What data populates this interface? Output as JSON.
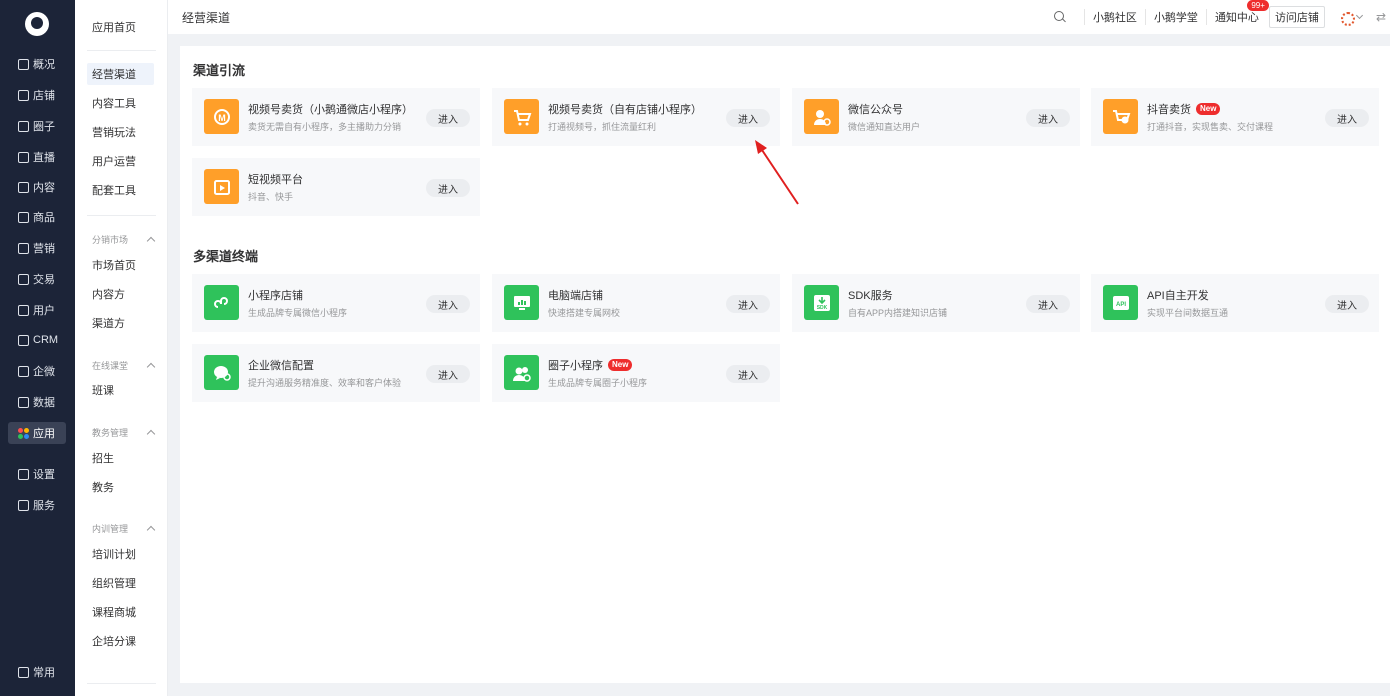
{
  "rail": {
    "items": [
      {
        "label": "概况",
        "icon": "overview-icon"
      },
      {
        "label": "店铺",
        "icon": "shop-icon"
      },
      {
        "label": "圈子",
        "icon": "circle-icon"
      },
      {
        "label": "直播",
        "icon": "live-icon"
      },
      {
        "label": "内容",
        "icon": "content-icon"
      },
      {
        "label": "商品",
        "icon": "goods-icon"
      },
      {
        "label": "营销",
        "icon": "marketing-icon"
      },
      {
        "label": "交易",
        "icon": "trade-icon"
      },
      {
        "label": "用户",
        "icon": "user-icon"
      },
      {
        "label": "CRM",
        "icon": "crm-icon"
      },
      {
        "label": "企微",
        "icon": "wecom-icon"
      },
      {
        "label": "数据",
        "icon": "data-icon"
      },
      {
        "label": "应用",
        "icon": "apps-icon"
      },
      {
        "label": "设置",
        "icon": "settings-icon"
      },
      {
        "label": "服务",
        "icon": "service-icon"
      },
      {
        "label": "常用",
        "icon": "frequent-icon"
      }
    ],
    "active_label": "应用"
  },
  "sub": {
    "home": "应用首页",
    "items_top": [
      "经营渠道",
      "内容工具",
      "营销玩法",
      "用户运营",
      "配套工具"
    ],
    "groups": [
      {
        "title": "分销市场",
        "items": [
          "市场首页",
          "内容方",
          "渠道方"
        ]
      },
      {
        "title": "在线课堂",
        "items": [
          "班课"
        ]
      },
      {
        "title": "教务管理",
        "items": [
          "招生",
          "教务"
        ]
      },
      {
        "title": "内训管理",
        "items": [
          "培训计划",
          "组织管理",
          "课程商城",
          "企培分课"
        ]
      }
    ]
  },
  "header": {
    "title": "经营渠道",
    "links": [
      "小鹅社区",
      "小鹅学堂",
      "通知中心"
    ],
    "badge": "99+",
    "visit": "访问店铺",
    "switch_glyph": "⇄"
  },
  "sections": [
    {
      "title": "渠道引流",
      "cards": [
        {
          "title": "视频号卖货（小鹅通微店小程序）",
          "desc": "卖货无需自有小程序，多主播助力分销",
          "color": "orange",
          "icon": "video-shop-icon",
          "new": false
        },
        {
          "title": "视频号卖货（自有店铺小程序）",
          "desc": "打通视频号，抓住流量红利",
          "color": "orange",
          "icon": "cart-icon",
          "new": false
        },
        {
          "title": "微信公众号",
          "desc": "微信通知直达用户",
          "color": "orange",
          "icon": "wechat-official-icon",
          "new": false
        },
        {
          "title": "抖音卖货",
          "desc": "打通抖音，实现售卖、交付课程",
          "color": "orange",
          "icon": "douyin-cart-icon",
          "new": true
        },
        {
          "title": "短视频平台",
          "desc": "抖音、快手",
          "color": "orange",
          "icon": "short-video-icon",
          "new": false
        }
      ]
    },
    {
      "title": "多渠道终端",
      "cards": [
        {
          "title": "小程序店铺",
          "desc": "生成品牌专属微信小程序",
          "color": "green",
          "icon": "mini-program-icon",
          "new": false
        },
        {
          "title": "电脑端店铺",
          "desc": "快速搭建专属网校",
          "color": "green",
          "icon": "pc-shop-icon",
          "new": false
        },
        {
          "title": "SDK服务",
          "desc": "自有APP内搭建知识店铺",
          "color": "green",
          "icon": "sdk-icon",
          "new": false
        },
        {
          "title": "API自主开发",
          "desc": "实现平台间数据互通",
          "color": "green",
          "icon": "api-icon",
          "new": false
        },
        {
          "title": "企业微信配置",
          "desc": "提升沟通服务精准度、效率和客户体验",
          "color": "green",
          "icon": "wecom-config-icon",
          "new": false
        },
        {
          "title": "圈子小程序",
          "desc": "生成品牌专属圈子小程序",
          "color": "green",
          "icon": "circle-mini-icon",
          "new": true
        }
      ]
    }
  ],
  "enter_label": "进入",
  "new_label": "New",
  "colors": {
    "rail_bg": "#1c2438",
    "orange": "#ff9f29",
    "green": "#2fc25b",
    "badge": "#ee2d2d",
    "arrow": "#e02020"
  }
}
